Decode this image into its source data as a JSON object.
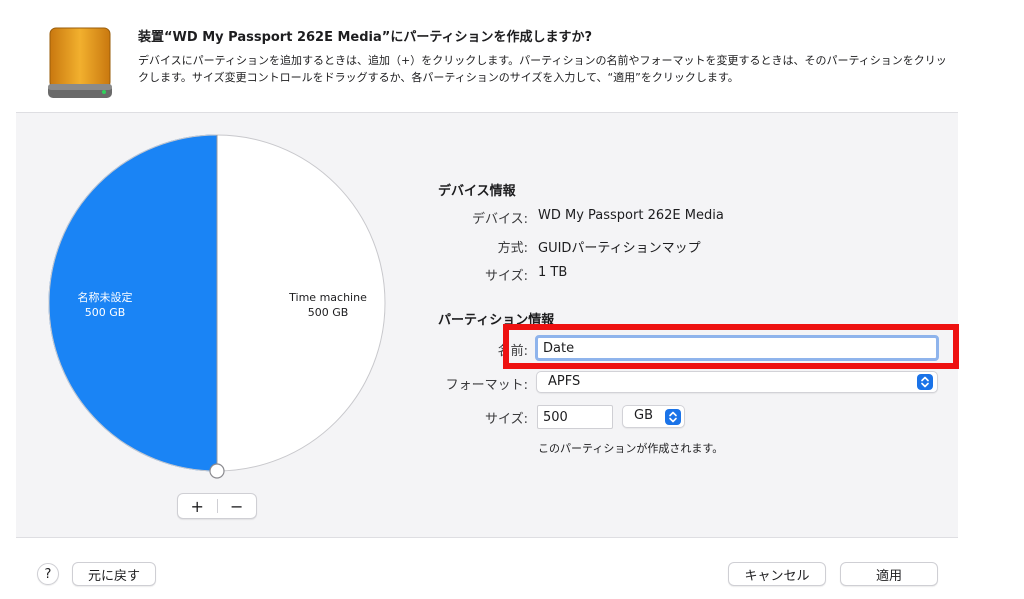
{
  "dialog": {
    "title": "装置“WD My Passport 262E Media”にパーティションを作成しますか?",
    "description": "デバイスにパーティションを追加するときは、追加（+）をクリックします。パーティションの名前やフォーマットを変更するときは、そのパーティションをクリックします。サイズ変更コントロールをドラッグするか、各パーティションのサイズを入力して、“適用”をクリックします。"
  },
  "partitions": [
    {
      "name": "名称未設定",
      "size": "500 GB",
      "color": "#1a84f5"
    },
    {
      "name": "Time machine",
      "size": "500 GB",
      "color": "#ffffff"
    }
  ],
  "plus_minus": {
    "add": "+",
    "remove": "−"
  },
  "device_info": {
    "heading": "デバイス情報",
    "device_label": "デバイス:",
    "device_value": "WD My Passport 262E Media",
    "scheme_label": "方式:",
    "scheme_value": "GUIDパーティションマップ",
    "size_label": "サイズ:",
    "size_value": "1 TB"
  },
  "partition_info": {
    "heading": "パーティション情報",
    "name_label": "名前:",
    "name_value": "Date",
    "format_label": "フォーマット:",
    "format_value": "APFS",
    "size_label": "サイズ:",
    "size_value": "500",
    "unit_value": "GB",
    "note": "このパーティションが作成されます。"
  },
  "footer": {
    "help": "?",
    "revert": "元に戻す",
    "cancel": "キャンセル",
    "apply": "適用"
  },
  "colors": {
    "accent": "#1a73e8",
    "highlight": "#ee1111",
    "drive": "#e89a1c"
  },
  "icons": [
    "external-drive-icon",
    "chevron-updown-icon",
    "resize-handle-icon"
  ]
}
